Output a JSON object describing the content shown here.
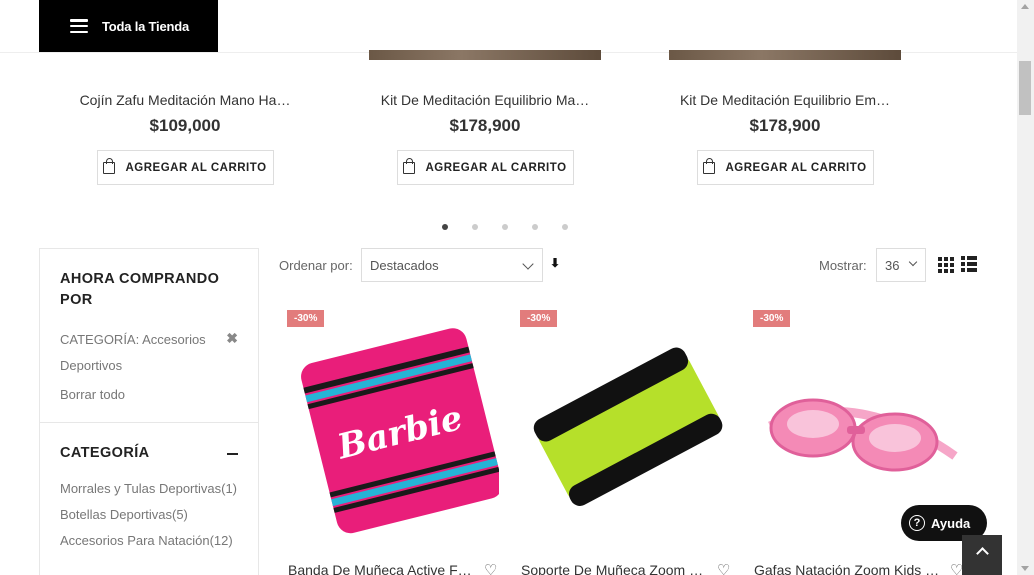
{
  "header": {
    "store_button_label": "Toda la Tienda"
  },
  "carousel": {
    "items": [
      {
        "name": "Cojín Zafu Meditación Mano Ha…",
        "price": "$109,000",
        "button": "AGREGAR AL CARRITO"
      },
      {
        "name": "Kit De Meditación Equilibrio Ma…",
        "price": "$178,900",
        "button": "AGREGAR AL CARRITO"
      },
      {
        "name": "Kit De Meditación Equilibrio Em…",
        "price": "$178,900",
        "button": "AGREGAR AL CARRITO"
      }
    ],
    "dot_count": 5,
    "active_dot": 1
  },
  "sidebar": {
    "now_shopping_title": "AHORA COMPRANDO POR",
    "active_filter_line1": "CATEGORÍA: Accesorios",
    "active_filter_line2": "Deportivos",
    "remove_filter_symbol": "✖",
    "clear_all": "Borrar todo",
    "category_title": "CATEGORÍA",
    "categories": [
      "Morrales y Tulas Deportivas(1)",
      "Botellas Deportivas(5)",
      "Accesorios Para Natación(12)"
    ]
  },
  "toolbar": {
    "sort_label": "Ordenar por:",
    "sort_value": "Destacados",
    "sort_direction_symbol": "⬇",
    "show_label": "Mostrar:",
    "show_value": "36"
  },
  "products": [
    {
      "badge": "-30%",
      "name": "Banda De Muñeca Active F…"
    },
    {
      "badge": "-30%",
      "name": "Soporte De Muñeca Zoom …"
    },
    {
      "badge": "-30%",
      "name": "Gafas Natación Zoom Kids …"
    }
  ],
  "help": {
    "label": "Ayuda",
    "icon_text": "?"
  },
  "colors": {
    "badge": "#e27c7c",
    "dark": "#000000"
  }
}
